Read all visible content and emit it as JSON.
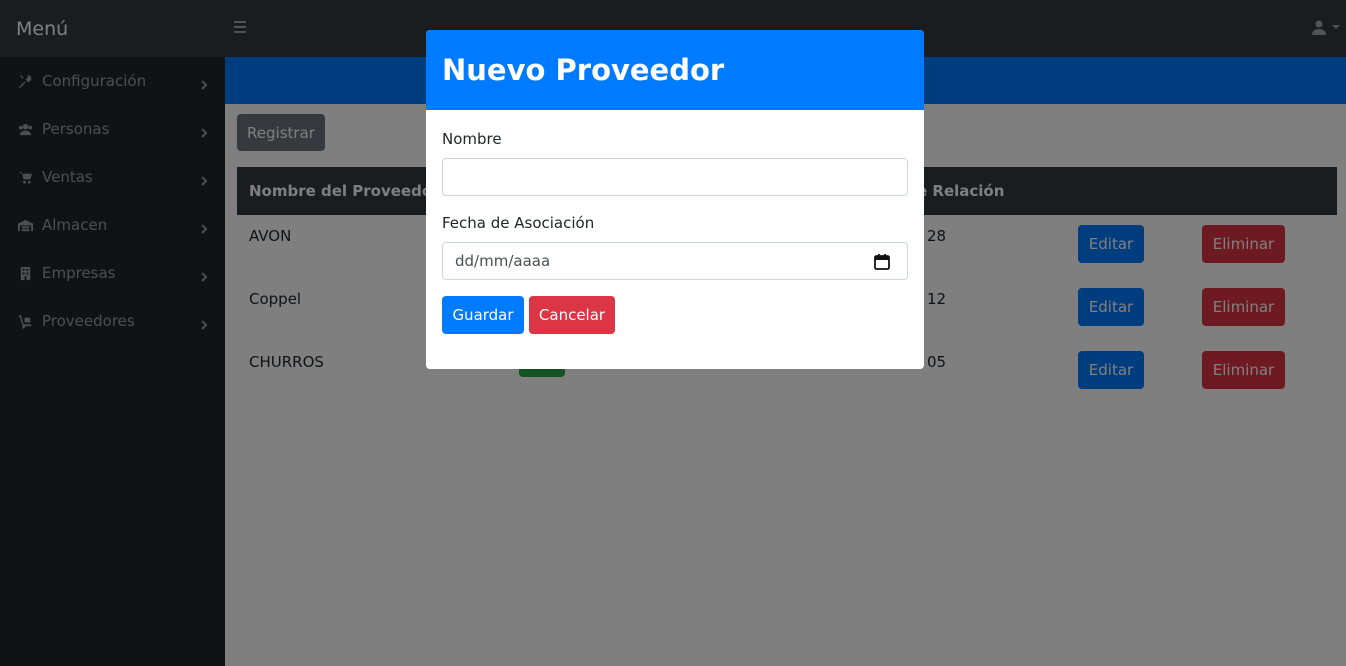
{
  "sidebar": {
    "title": "Menú",
    "items": [
      {
        "label": "Configuración",
        "icon": "tools-icon"
      },
      {
        "label": "Personas",
        "icon": "users-icon"
      },
      {
        "label": "Ventas",
        "icon": "cart-icon"
      },
      {
        "label": "Almacen",
        "icon": "warehouse-icon"
      },
      {
        "label": "Empresas",
        "icon": "building-icon"
      },
      {
        "label": "Proveedores",
        "icon": "dolly-icon"
      }
    ]
  },
  "toolbar": {
    "register_label": "Registrar"
  },
  "table": {
    "headers": [
      "Nombre del Proveedor",
      "e Relación"
    ],
    "rows": [
      {
        "name": "AVON",
        "date_fragment": "28",
        "edit": "Editar",
        "delete": "Eliminar"
      },
      {
        "name": "Coppel",
        "date_fragment": "12",
        "edit": "Editar",
        "delete": "Eliminar"
      },
      {
        "name": "CHURROS",
        "date_fragment": "05",
        "edit": "Editar",
        "delete": "Eliminar"
      }
    ]
  },
  "modal": {
    "title": "Nuevo Proveedor",
    "name_label": "Nombre",
    "name_value": "",
    "date_label": "Fecha de Asociación",
    "date_placeholder": "dd/mm/aaaa",
    "save_label": "Guardar",
    "cancel_label": "Cancelar"
  },
  "colors": {
    "primary": "#007bff",
    "danger": "#dc3545",
    "secondary": "#6c757d",
    "success": "#28a745",
    "dark": "#343a40"
  }
}
